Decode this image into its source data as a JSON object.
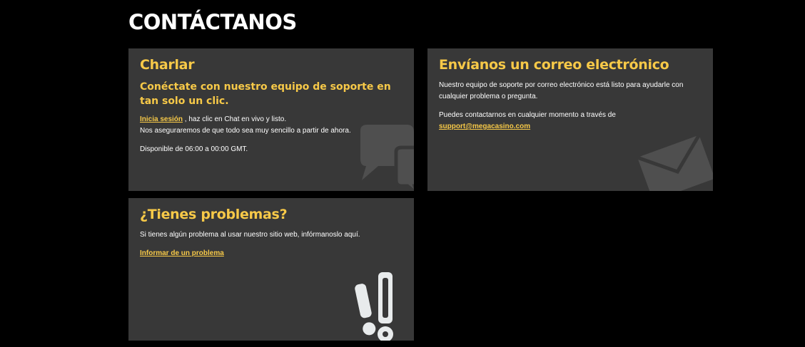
{
  "page": {
    "title": "CONTÁCTANOS"
  },
  "chat": {
    "title": "Charlar",
    "subtitle": "Conéctate con nuestro equipo de soporte en tan solo un clic.",
    "login_link": "Inicia sesión",
    "line1_rest": " , haz clic en Chat en vivo y listo.",
    "line2": "Nos aseguraremos de que todo sea muy sencillo a partir de ahora.",
    "availability": "Disponible de 06:00 a 00:00 GMT.",
    "icon": "chat-bubbles-icon"
  },
  "email": {
    "title": "Envíanos un correo electrónico",
    "description": "Nuestro equipo de soporte por correo electrónico está listo para ayudarle con cualquier problema o pregunta.",
    "contact_text": "Puedes contactarnos en cualquier momento a través de",
    "email_address": "support@megacasino.com",
    "icon": "envelope-icon"
  },
  "problem": {
    "title": "¿Tienes problemas?",
    "description": "Si tienes algún problema al usar nuestro sitio web, infórmanoslo aquí.",
    "report_link": "Informar de un problema",
    "icon": "exclamation-marks-icon"
  },
  "colors": {
    "background": "#000000",
    "card": "#383838",
    "accent": "#f7c948",
    "text": "#ffffff"
  }
}
